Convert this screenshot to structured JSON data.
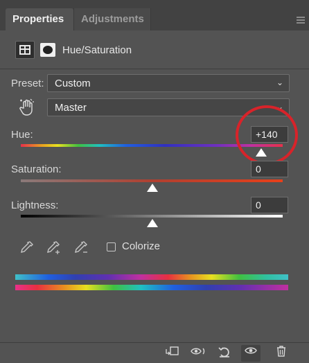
{
  "tabs": [
    {
      "label": "Properties",
      "active": true
    },
    {
      "label": "Adjustments",
      "active": false
    }
  ],
  "header": {
    "title": "Hue/Saturation"
  },
  "preset": {
    "label": "Preset:",
    "value": "Custom"
  },
  "channel": {
    "value": "Master"
  },
  "hue": {
    "label": "Hue:",
    "value": "+140"
  },
  "saturation": {
    "label": "Saturation:",
    "value": "0"
  },
  "lightness": {
    "label": "Lightness:",
    "value": "0"
  },
  "colorize": {
    "label": "Colorize",
    "checked": false
  },
  "sliders": {
    "hue_position": 0.91,
    "saturation_position": 0.5,
    "lightness_position": 0.5
  },
  "colors": {
    "highlight_circle": "#d8232a",
    "panel_bg": "#535353"
  },
  "footer_icons": [
    "clip-to-layer-icon",
    "view-previous-state-icon",
    "reset-icon",
    "visibility-icon",
    "delete-icon"
  ]
}
